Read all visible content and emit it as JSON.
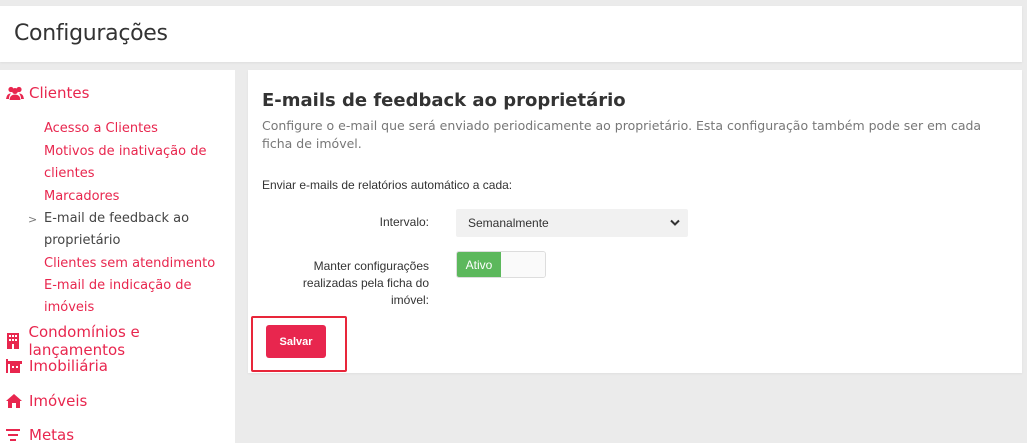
{
  "header": {
    "title": "Configurações"
  },
  "sidebar": {
    "sections": [
      {
        "label": "Clientes",
        "icon": "users-icon"
      },
      {
        "label": "Condomínios e lançamentos",
        "icon": "building-icon"
      },
      {
        "label": "Imobiliária",
        "icon": "office-icon"
      },
      {
        "label": "Imóveis",
        "icon": "home-icon"
      },
      {
        "label": "Metas",
        "icon": "filter-icon"
      }
    ],
    "clientes_items": [
      "Acesso a Clientes",
      "Motivos de inativação de clientes",
      "Marcadores",
      "E-mail de feedback ao proprietário",
      "Clientes sem atendimento",
      "E-mail de indicação de imóveis"
    ],
    "active_item": "E-mail de feedback ao proprietário",
    "active_marker": ">"
  },
  "main": {
    "title": "E-mails de feedback ao proprietário",
    "description": "Configure o e-mail que será enviado periodicamente ao proprietário. Esta configuração também pode ser em cada ficha de imóvel.",
    "send_label": "Enviar e-mails de relatórios automático a cada:",
    "interval_label": "Intervalo:",
    "interval_value": "Semanalmente",
    "keep_label": "Manter configurações realizadas pela ficha do imóvel:",
    "toggle_label": "Ativo",
    "toggle_on": true,
    "save_label": "Salvar"
  },
  "colors": {
    "accent": "#e8264e",
    "toggle_on": "#5cb85c",
    "highlight_border": "#e8263a"
  }
}
